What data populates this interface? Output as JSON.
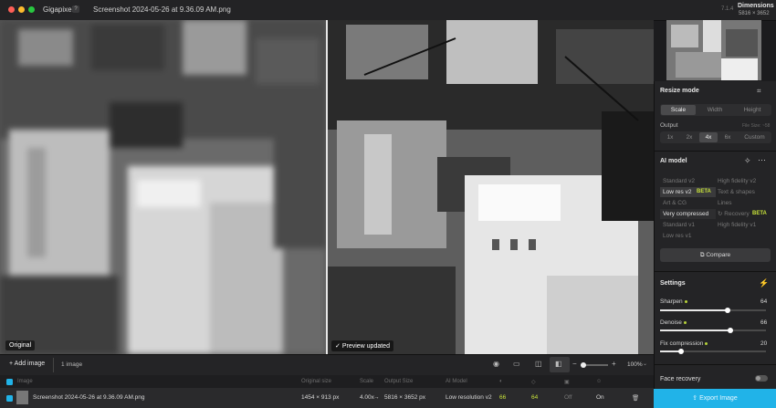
{
  "app": {
    "name": "Gigapixel",
    "help_label": "?",
    "file_title": "Screenshot 2024-05-26 at 9.36.09 AM.png",
    "version": "7.1.4"
  },
  "dimensions": {
    "title": "Dimensions",
    "value": "5816 × 3652"
  },
  "preview": {
    "left_label": "Original",
    "right_label": "Preview updated"
  },
  "resize": {
    "title": "Resize mode",
    "modes": [
      "Scale",
      "Width",
      "Height"
    ],
    "output_label": "Output",
    "output_hint": "File Size: ~58",
    "scales": [
      "1x",
      "2x",
      "4x",
      "6x",
      "Custom"
    ]
  },
  "ai_model": {
    "title": "AI model",
    "rows": [
      [
        "Standard v2",
        "High fidelity v2"
      ],
      [
        "Low res v2",
        "Text & shapes"
      ],
      [
        "Art & CG",
        "Lines"
      ],
      [
        "Very compressed",
        "Recovery"
      ],
      [
        "Standard v1",
        "High fidelity v1"
      ],
      [
        "Low res v1",
        ""
      ]
    ],
    "beta": "BETA",
    "compare": "Compare"
  },
  "settings": {
    "title": "Settings",
    "sliders": [
      {
        "label": "Sharpen",
        "value": "64",
        "level": 0.64
      },
      {
        "label": "Denoise",
        "value": "66",
        "level": 0.66
      },
      {
        "label": "Fix compression",
        "value": "20",
        "level": 0.2
      }
    ]
  },
  "face_recovery": {
    "label": "Face recovery"
  },
  "toolbar": {
    "add_image": "Add image",
    "count": "1 image",
    "zoom": "100%"
  },
  "table": {
    "headers": [
      "Image",
      "Original size",
      "Scale",
      "Output Size",
      "AI Model"
    ],
    "row": {
      "name": "Screenshot 2024-05-26 at 9.36.09 AM.png",
      "original_size": "1454 × 913 px",
      "scale": "4.00x",
      "output": "5816 × 3652 px",
      "model": "Low resolution v2",
      "v1": "66",
      "v2": "64",
      "v3": "Off",
      "v4": "On"
    }
  },
  "export": "Export Image",
  "colors": {
    "accent": "#21b3e8",
    "beta": "#c6e03a",
    "panel": "#242426"
  }
}
